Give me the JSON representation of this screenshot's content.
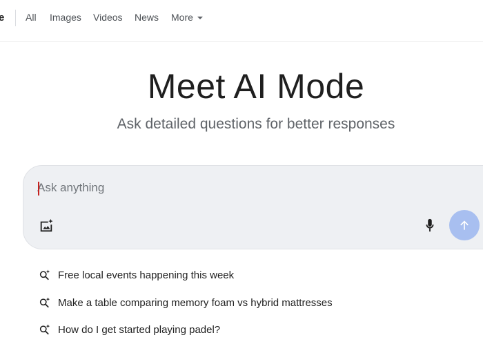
{
  "nav": {
    "partial_tab": "e",
    "tabs": [
      "All",
      "Images",
      "Videos",
      "News"
    ],
    "more_label": "More"
  },
  "hero": {
    "title": "Meet AI Mode",
    "subtitle": "Ask detailed questions for better responses"
  },
  "search": {
    "value": "",
    "placeholder": "Ask anything",
    "icons": [
      "add-image-icon",
      "mic-icon",
      "arrow-up-icon"
    ],
    "submit_color": "#a8bff0"
  },
  "suggestions": [
    "Free local events happening this week",
    "Make a table comparing memory foam vs hybrid mattresses",
    "How do I get started playing padel?"
  ]
}
